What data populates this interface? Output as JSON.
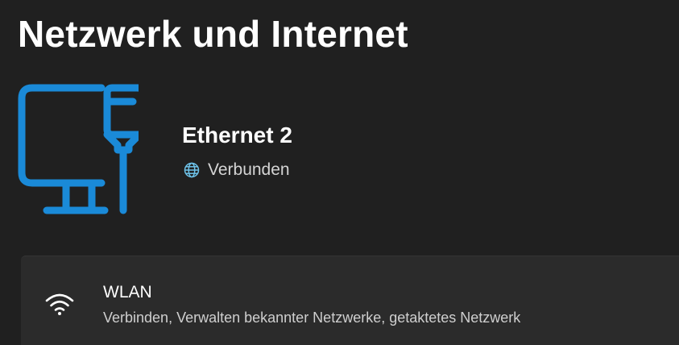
{
  "header": {
    "title": "Netzwerk und Internet"
  },
  "connection": {
    "icon": "ethernet-pc-icon",
    "name": "Ethernet 2",
    "status_icon": "globe-icon",
    "status": "Verbunden",
    "accent_color": "#1a8ad8",
    "status_icon_color": "#6ec3ea"
  },
  "settings": {
    "items": [
      {
        "icon": "wifi-icon",
        "title": "WLAN",
        "description": "Verbinden, Verwalten bekannter Netzwerke, getaktetes Netzwerk"
      }
    ]
  }
}
